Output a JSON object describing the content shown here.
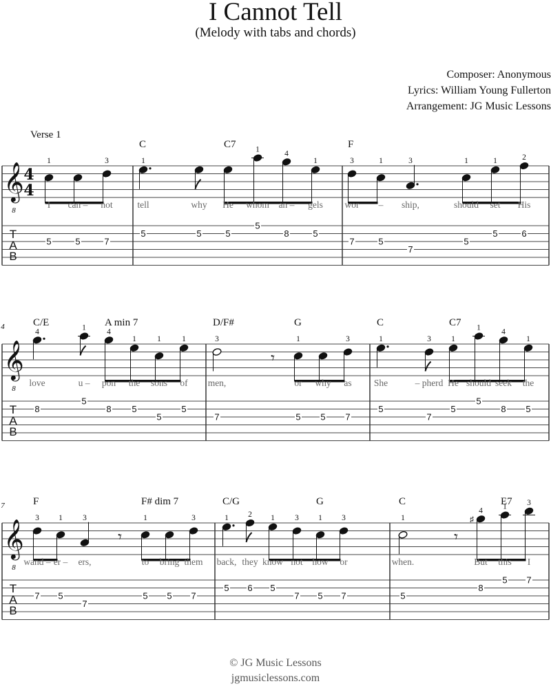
{
  "header": {
    "title": "I Cannot Tell",
    "subtitle": "(Melody with tabs and chords)",
    "composer": "Composer: Anonymous",
    "lyrics": "Lyrics: William Young Fullerton",
    "arrangement": "Arrangement: JG Music Lessons"
  },
  "section_label": "Verse 1",
  "time_signature": "4/4",
  "tab_label": [
    "T",
    "A",
    "B"
  ],
  "systems": [
    {
      "measure_number": "",
      "measures": [
        {
          "chords": [],
          "notes": [
            {
              "pitch": "C5",
              "dur": "8",
              "finger": "1",
              "fret": "5",
              "string": 3,
              "lyric": "I",
              "beam": 1
            },
            {
              "pitch": "C5",
              "dur": "8",
              "finger": "",
              "fret": "5",
              "string": 3,
              "lyric": "can –",
              "beam": 1
            },
            {
              "pitch": "D5",
              "dur": "8",
              "finger": "3",
              "fret": "7",
              "string": 3,
              "lyric": "not",
              "beam": 1
            }
          ]
        },
        {
          "chords": [
            {
              "label": "C",
              "at": 0
            },
            {
              "label": "C7",
              "at": 2
            }
          ],
          "notes": [
            {
              "pitch": "E5",
              "dur": "4.",
              "finger": "1",
              "fret": "5",
              "string": 2,
              "lyric": "tell"
            },
            {
              "pitch": "E5",
              "dur": "8",
              "finger": "",
              "fret": "5",
              "string": 2,
              "lyric": "why"
            },
            {
              "pitch": "E5",
              "dur": "8",
              "finger": "",
              "fret": "5",
              "string": 2,
              "lyric": "He",
              "beam": 1
            },
            {
              "pitch": "A5",
              "dur": "8",
              "finger": "1",
              "fret": "5",
              "string": 1,
              "lyric": "whom",
              "beam": 1
            },
            {
              "pitch": "G5",
              "dur": "8",
              "finger": "4",
              "fret": "8",
              "string": 2,
              "lyric": "an –",
              "beam": 1
            },
            {
              "pitch": "E5",
              "dur": "8",
              "finger": "1",
              "fret": "5",
              "string": 2,
              "lyric": "gels",
              "beam": 1
            }
          ]
        },
        {
          "chords": [
            {
              "label": "F",
              "at": 0
            }
          ],
          "notes": [
            {
              "pitch": "D5",
              "dur": "8",
              "finger": "3",
              "fret": "7",
              "string": 3,
              "lyric": "wor",
              "beam": 1
            },
            {
              "pitch": "C5",
              "dur": "8",
              "finger": "1",
              "fret": "5",
              "string": 3,
              "lyric": "–",
              "beam": 1
            },
            {
              "pitch": "A4",
              "dur": "4.",
              "finger": "3",
              "fret": "7",
              "string": 4,
              "lyric": "ship,"
            },
            {
              "pitch": "C5",
              "dur": "8",
              "finger": "1",
              "fret": "5",
              "string": 3,
              "lyric": "should",
              "beam": 2
            },
            {
              "pitch": "E5",
              "dur": "8",
              "finger": "1",
              "fret": "5",
              "string": 2,
              "lyric": "set",
              "beam": 2
            },
            {
              "pitch": "F5",
              "dur": "8",
              "finger": "2",
              "fret": "6",
              "string": 2,
              "lyric": "His",
              "beam": 2
            }
          ]
        }
      ]
    },
    {
      "measure_number": "4",
      "measures": [
        {
          "chords": [
            {
              "label": "C/E",
              "at": 0
            },
            {
              "label": "A min 7",
              "at": 2
            }
          ],
          "notes": [
            {
              "pitch": "G5",
              "dur": "4.",
              "finger": "4",
              "fret": "8",
              "string": 2,
              "lyric": "love"
            },
            {
              "pitch": "A5",
              "dur": "8",
              "finger": "1",
              "fret": "5",
              "string": 1,
              "lyric": "u –"
            },
            {
              "pitch": "G5",
              "dur": "8",
              "finger": "4",
              "fret": "8",
              "string": 2,
              "lyric": "pon",
              "beam": 1
            },
            {
              "pitch": "E5",
              "dur": "8",
              "finger": "1",
              "fret": "5",
              "string": 2,
              "lyric": "the",
              "beam": 1
            },
            {
              "pitch": "C5",
              "dur": "8",
              "finger": "1",
              "fret": "5",
              "string": 3,
              "lyric": "sons",
              "beam": 1
            },
            {
              "pitch": "E5",
              "dur": "8",
              "finger": "1",
              "fret": "5",
              "string": 2,
              "lyric": "of",
              "beam": 1
            }
          ]
        },
        {
          "chords": [
            {
              "label": "D/F#",
              "at": 0
            },
            {
              "label": "G",
              "at": 2
            }
          ],
          "notes": [
            {
              "pitch": "D5",
              "dur": "2",
              "finger": "3",
              "fret": "7",
              "string": 3,
              "lyric": "men,"
            },
            {
              "rest": "8"
            },
            {
              "pitch": "C5",
              "dur": "8",
              "finger": "1",
              "fret": "5",
              "string": 3,
              "lyric": "or",
              "beam": 1
            },
            {
              "pitch": "C5",
              "dur": "8",
              "finger": "",
              "fret": "5",
              "string": 3,
              "lyric": "why",
              "beam": 1
            },
            {
              "pitch": "D5",
              "dur": "8",
              "finger": "3",
              "fret": "7",
              "string": 3,
              "lyric": "as",
              "beam": 1
            }
          ]
        },
        {
          "chords": [
            {
              "label": "C",
              "at": 0
            },
            {
              "label": "C7",
              "at": 2
            }
          ],
          "notes": [
            {
              "pitch": "E5",
              "dur": "4.",
              "finger": "1",
              "fret": "5",
              "string": 2,
              "lyric": "She"
            },
            {
              "pitch": "D5",
              "dur": "8",
              "finger": "3",
              "fret": "7",
              "string": 3,
              "lyric": "– pherd"
            },
            {
              "pitch": "E5",
              "dur": "8",
              "finger": "1",
              "fret": "5",
              "string": 2,
              "lyric": "He",
              "beam": 1
            },
            {
              "pitch": "A5",
              "dur": "8",
              "finger": "1",
              "fret": "5",
              "string": 1,
              "lyric": "should",
              "beam": 1
            },
            {
              "pitch": "G5",
              "dur": "8",
              "finger": "4",
              "fret": "8",
              "string": 2,
              "lyric": "seek",
              "beam": 1
            },
            {
              "pitch": "E5",
              "dur": "8",
              "finger": "1",
              "fret": "5",
              "string": 2,
              "lyric": "the",
              "beam": 1
            }
          ]
        }
      ]
    },
    {
      "measure_number": "7",
      "measures": [
        {
          "chords": [
            {
              "label": "F",
              "at": 0
            },
            {
              "label": "F# dim 7",
              "at": 4
            }
          ],
          "notes": [
            {
              "pitch": "D5",
              "dur": "8",
              "finger": "3",
              "fret": "7",
              "string": 3,
              "lyric": "wand –",
              "beam": 1
            },
            {
              "pitch": "C5",
              "dur": "8",
              "finger": "1",
              "fret": "5",
              "string": 3,
              "lyric": "er –",
              "beam": 1
            },
            {
              "pitch": "A4",
              "dur": "4",
              "finger": "3",
              "fret": "7",
              "string": 4,
              "lyric": "ers,"
            },
            {
              "rest": "8"
            },
            {
              "pitch": "C5",
              "dur": "8",
              "finger": "1",
              "fret": "5",
              "string": 3,
              "lyric": "to",
              "beam": 2
            },
            {
              "pitch": "C5",
              "dur": "8",
              "finger": "",
              "fret": "5",
              "string": 3,
              "lyric": "bring",
              "beam": 2
            },
            {
              "pitch": "D5",
              "dur": "8",
              "finger": "3",
              "fret": "7",
              "string": 3,
              "lyric": "them",
              "beam": 2
            }
          ]
        },
        {
          "chords": [
            {
              "label": "C/G",
              "at": 0
            },
            {
              "label": "G",
              "at": 4
            }
          ],
          "notes": [
            {
              "pitch": "E5",
              "dur": "4.",
              "finger": "1",
              "fret": "5",
              "string": 2,
              "lyric": "back,"
            },
            {
              "pitch": "F5",
              "dur": "8",
              "finger": "2",
              "fret": "6",
              "string": 2,
              "lyric": "they"
            },
            {
              "pitch": "E5",
              "dur": "8",
              "finger": "1",
              "fret": "5",
              "string": 2,
              "lyric": "know",
              "beam": 1
            },
            {
              "pitch": "D5",
              "dur": "8",
              "finger": "3",
              "fret": "7",
              "string": 3,
              "lyric": "not",
              "beam": 1
            },
            {
              "pitch": "C5",
              "dur": "8",
              "finger": "1",
              "fret": "5",
              "string": 3,
              "lyric": "how",
              "beam": 1
            },
            {
              "pitch": "D5",
              "dur": "8",
              "finger": "3",
              "fret": "7",
              "string": 3,
              "lyric": "or",
              "beam": 1
            }
          ]
        },
        {
          "chords": [
            {
              "label": "C",
              "at": 0
            },
            {
              "label": "E7",
              "at": 3
            }
          ],
          "notes": [
            {
              "pitch": "C5",
              "dur": "2",
              "finger": "1",
              "fret": "5",
              "string": 3,
              "lyric": "when."
            },
            {
              "rest": "8"
            },
            {
              "pitch": "G#5",
              "dur": "8",
              "finger": "4",
              "fret": "8",
              "string": 2,
              "lyric": "But",
              "beam": 1
            },
            {
              "pitch": "A5",
              "dur": "8",
              "finger": "1",
              "fret": "5",
              "string": 1,
              "lyric": "this",
              "beam": 1
            },
            {
              "pitch": "B5",
              "dur": "8",
              "finger": "3",
              "fret": "7",
              "string": 1,
              "lyric": "I",
              "beam": 1
            }
          ]
        }
      ]
    }
  ],
  "footer": {
    "copyright": "© JG Music Lessons",
    "website": "jgmusiclessons.com"
  }
}
